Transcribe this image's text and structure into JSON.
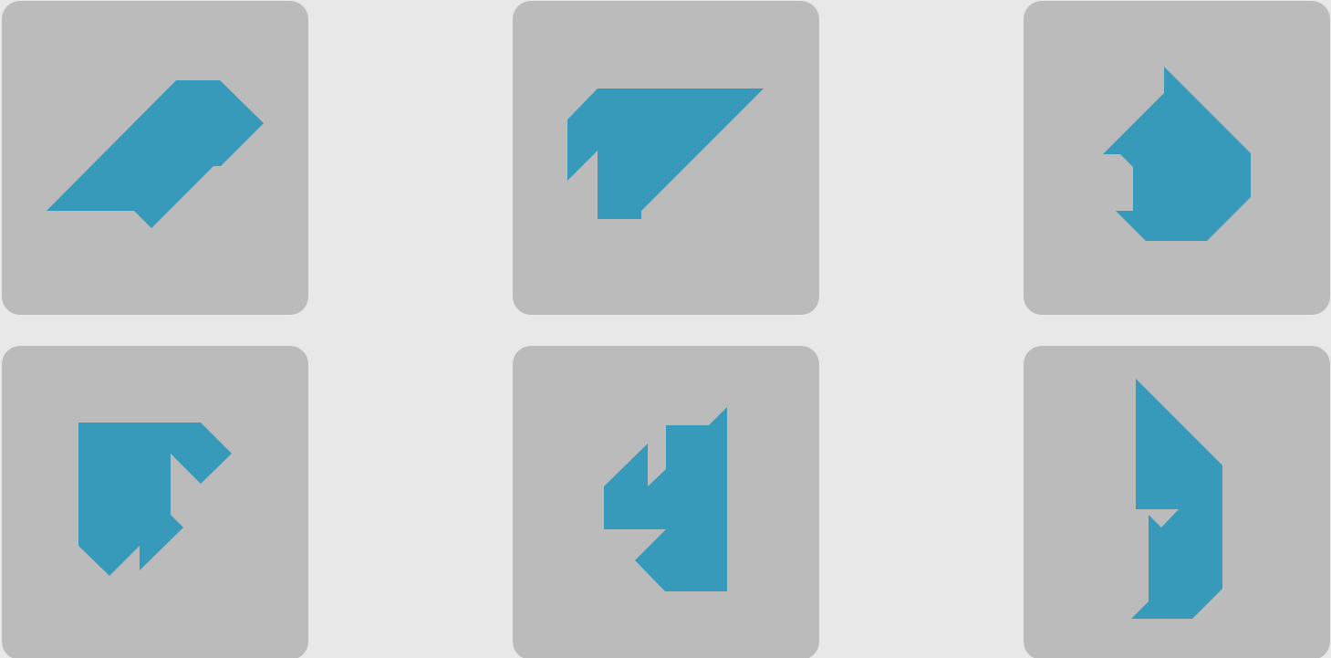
{
  "colors": {
    "background": "#e8e8e8",
    "tile": "#bbbbbb",
    "silhouette": "#389aba"
  },
  "options": [
    {
      "shape_icon": "tangram-silhouette-1"
    },
    {
      "shape_icon": "tangram-silhouette-2"
    },
    {
      "shape_icon": "tangram-silhouette-3"
    },
    {
      "shape_icon": "tangram-silhouette-4"
    },
    {
      "shape_icon": "tangram-silhouette-5"
    },
    {
      "shape_icon": "tangram-silhouette-6"
    }
  ]
}
